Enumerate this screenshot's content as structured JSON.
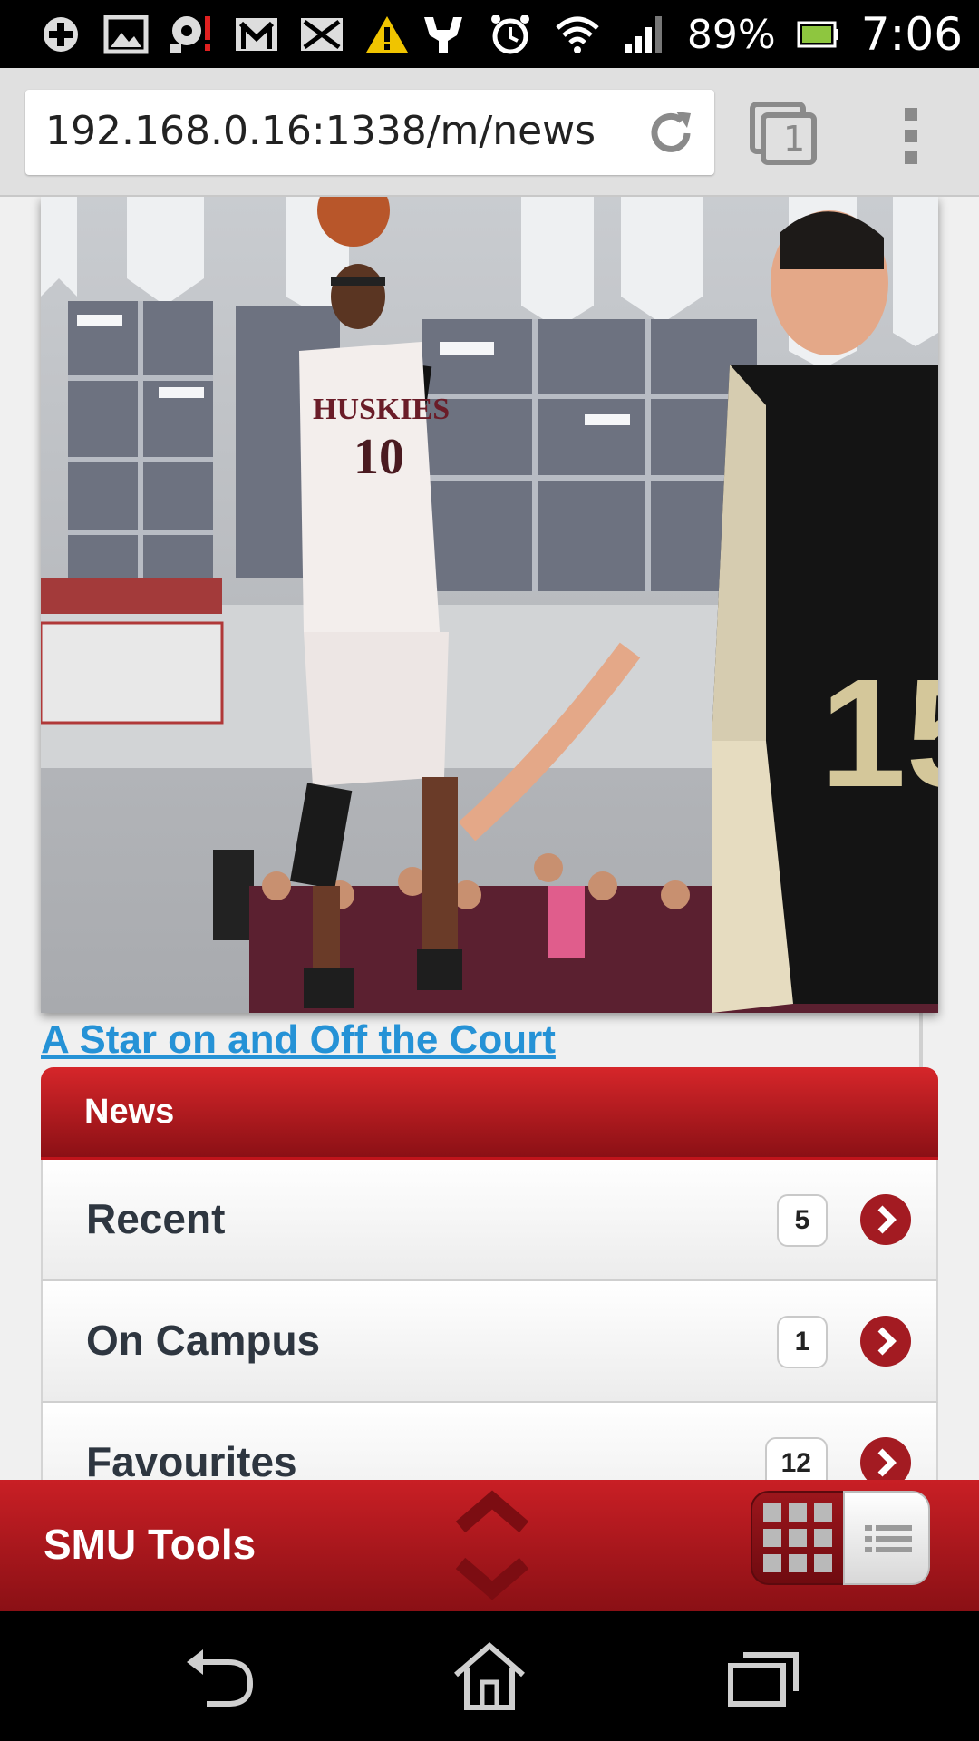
{
  "status_bar": {
    "left_icons": [
      "health-plus-icon",
      "image-icon",
      "voicemail-alert-icon",
      "gmail-icon",
      "email-icon",
      "warning-icon"
    ],
    "right_icons": [
      "usb-icon",
      "alarm-icon",
      "wifi-icon",
      "signal-icon"
    ],
    "battery": "89%",
    "time": "7:06"
  },
  "browser": {
    "url": "192.168.0.16:1338/m/news",
    "tab_count": "1"
  },
  "article": {
    "title": "A Star on and Off the Court"
  },
  "news_panel": {
    "header": "News",
    "items": [
      {
        "label": "Recent",
        "count": "5"
      },
      {
        "label": "On Campus",
        "count": "1"
      },
      {
        "label": "Favourites",
        "count": "12"
      }
    ]
  },
  "toolbar": {
    "title": "SMU Tools"
  },
  "colors": {
    "accent_red": "#c0141b",
    "link_blue": "#2592d6"
  }
}
